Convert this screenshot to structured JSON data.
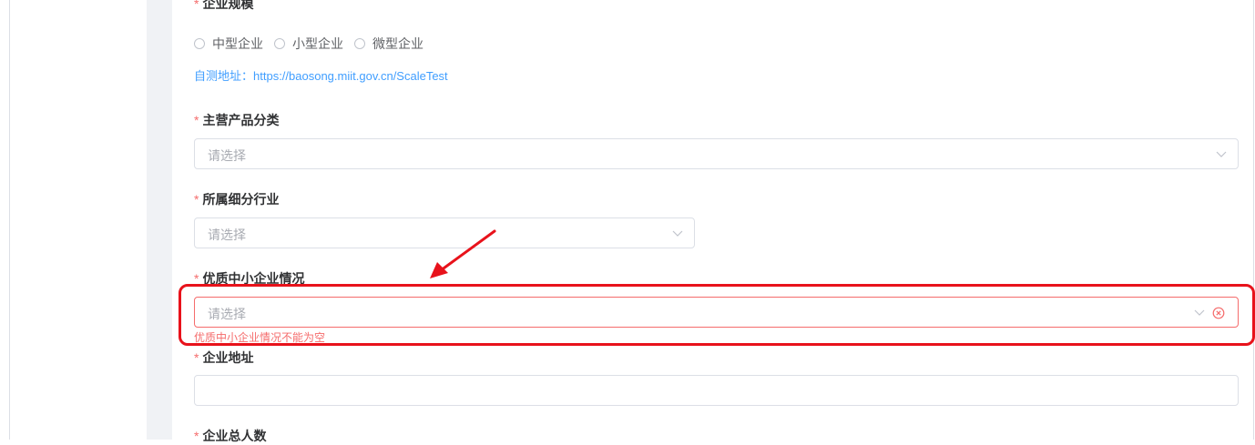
{
  "form": {
    "scale": {
      "required_mark": "*",
      "label": "企业规模",
      "options": [
        "中型企业",
        "小型企业",
        "微型企业"
      ],
      "self_test_prefix": "自测地址：",
      "self_test_url": "https://baosong.miit.gov.cn/ScaleTest"
    },
    "main_product": {
      "required_mark": "*",
      "label": "主营产品分类",
      "placeholder": "请选择"
    },
    "industry": {
      "required_mark": "*",
      "label": "所属细分行业",
      "placeholder": "请选择"
    },
    "quality_sme": {
      "required_mark": "*",
      "label": "优质中小企业情况",
      "placeholder": "请选择",
      "error": "优质中小企业情况不能为空"
    },
    "address": {
      "required_mark": "*",
      "label": "企业地址",
      "value": ""
    },
    "headcount": {
      "required_mark": "*",
      "label": "企业总人数"
    }
  },
  "colors": {
    "annotation_red": "#e8121b",
    "error_red": "#f56c6c",
    "link_blue": "#409eff"
  }
}
